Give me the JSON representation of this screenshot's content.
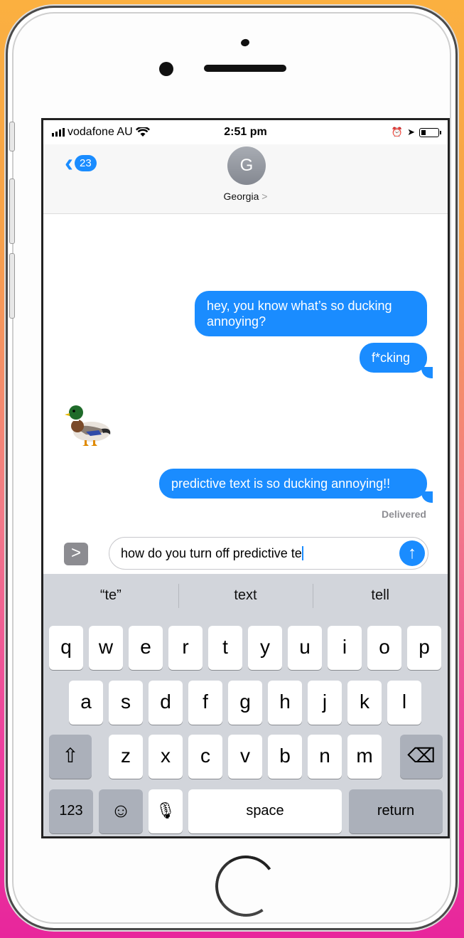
{
  "status_bar": {
    "carrier": "vodafone AU",
    "time": "2:51 pm",
    "icons": [
      "signal-bars-icon",
      "wifi-icon",
      "alarm-icon",
      "location-icon",
      "battery-icon"
    ]
  },
  "header": {
    "back_count": "23",
    "avatar_initial": "G",
    "contact_name": "Georgia",
    "contact_chevron": ">"
  },
  "messages": [
    {
      "direction": "outgoing",
      "text": "hey, you know what’s so ducking annoying?"
    },
    {
      "direction": "outgoing",
      "text": "f*cking"
    },
    {
      "direction": "incoming",
      "type": "emoji",
      "emoji": "duck"
    },
    {
      "direction": "outgoing",
      "text": "predictive text is so ducking annoying!!"
    }
  ],
  "delivery_status": "Delivered",
  "composer": {
    "expand_glyph": ">",
    "value": "how do you turn off predictive te",
    "send_glyph": "↑"
  },
  "keyboard": {
    "suggestions": [
      "“te”",
      "text",
      "tell"
    ],
    "row1": [
      "q",
      "w",
      "e",
      "r",
      "t",
      "y",
      "u",
      "i",
      "o",
      "p"
    ],
    "row2": [
      "a",
      "s",
      "d",
      "f",
      "g",
      "h",
      "j",
      "k",
      "l"
    ],
    "row3": [
      "z",
      "x",
      "c",
      "v",
      "b",
      "n",
      "m"
    ],
    "shift_glyph": "⇧",
    "delete_glyph": "⌫",
    "numbers_label": "123",
    "emoji_glyph": "☺",
    "mic_glyph": "🎙",
    "space_label": "space",
    "return_label": "return"
  },
  "colors": {
    "accent": "#1a8cff",
    "keyboard_bg": "#d2d5db",
    "background_top": "#fbb040",
    "background_bottom": "#e8269c"
  }
}
